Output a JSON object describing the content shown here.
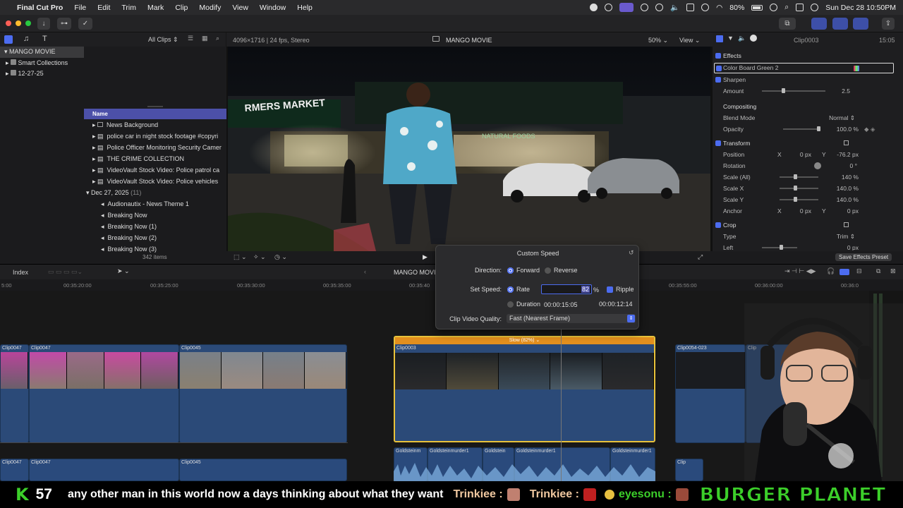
{
  "menubar": {
    "app": "Final Cut Pro",
    "items": [
      "File",
      "Edit",
      "Trim",
      "Mark",
      "Clip",
      "Modify",
      "View",
      "Window",
      "Help"
    ],
    "battery": "80%",
    "datetime": "Sun Dec 28  10:50PM"
  },
  "library": {
    "filter": "All Clips ⇕",
    "tree": [
      "MANGO MOVIE",
      "Smart Collections",
      "12-27-25"
    ],
    "col_name": "Name",
    "rows": [
      "News Background",
      "police  car in night stock footage #copyri",
      "Police Officer Monitoring Security Camer",
      "THE CRIME COLLECTION",
      "VideoVault Stock Video:   Police patrol ca",
      "VideoVault Stock Video:   Police vehicles"
    ],
    "date_group": "Dec 27, 2025",
    "date_count": "(11)",
    "audio_rows": [
      "Audionautix - News Theme 1",
      "Breaking Now",
      "Breaking Now (1)",
      "Breaking Now (2)",
      "Breaking Now (3)"
    ],
    "item_count": "342 items"
  },
  "viewer": {
    "format": "4096×1716 | 24 fps, Stereo",
    "title": "MANGO MOVIE",
    "zoom": "50% ⌄",
    "view": "View ⌄",
    "sign_text": "RMERS MARKET",
    "store_text": "NATURAL FOODS"
  },
  "inspector": {
    "clip": "Clip0003",
    "duration": "15:05",
    "effects_title": "Effects",
    "effects": [
      "Color Board Green 2",
      "Sharpen"
    ],
    "amount_label": "Amount",
    "amount_value": "2.5",
    "compositing": "Compositing",
    "blend_label": "Blend Mode",
    "blend_value": "Normal ⇕",
    "opacity_label": "Opacity",
    "opacity_value": "100.0  %",
    "transform": "Transform",
    "position_label": "Position",
    "pos_x_label": "X",
    "pos_x": "0  px",
    "pos_y_label": "Y",
    "pos_y": "-76.2  px",
    "rotation_label": "Rotation",
    "rotation": "0  °",
    "scale_all_label": "Scale (All)",
    "scale_all": "140  %",
    "scale_x_label": "Scale X",
    "scale_x": "140.0  %",
    "scale_y_label": "Scale Y",
    "scale_y": "140.0  %",
    "anchor_label": "Anchor",
    "anchor_x_label": "X",
    "anchor_x": "0  px",
    "anchor_y_label": "Y",
    "anchor_y": "0  px",
    "crop": "Crop",
    "type_label": "Type",
    "type_value": "Trim ⇕",
    "left_label": "Left",
    "left_value": "0  px",
    "save_preset": "Save Effects Preset"
  },
  "timeline_bar": {
    "index": "Index",
    "project": "MANGO MOVIE"
  },
  "ruler": [
    "5:00",
    "00:35:20:00",
    "00:35:25:00",
    "00:35:30:00",
    "00:35:35:00",
    "00:35:40",
    "00:35:55:00",
    "00:36:00:00",
    "00:36:0"
  ],
  "speed": {
    "title": "Custom Speed",
    "direction_label": "Direction:",
    "forward": "Forward",
    "reverse": "Reverse",
    "set_speed_label": "Set Speed:",
    "rate": "Rate",
    "rate_value": "82",
    "percent": "%",
    "ripple": "Ripple",
    "duration": "Duration",
    "duration_value": "00:00:15:05",
    "duration_alt": "00:00:12:14",
    "quality_label": "Clip Video Quality:",
    "quality_value": "Fast (Nearest Frame)"
  },
  "clips": {
    "c47a": "Clip0047",
    "c47b": "Clip0047",
    "c45": "Clip0045",
    "slow": "Slow (82%) ⌄",
    "c03": "Clip0003",
    "c54": "Clip0054-023",
    "c0": "Clip",
    "a47a": "Clip0047",
    "a47b": "Clip0047",
    "a45": "Clip0045",
    "gold1": "Goldsteinm",
    "gold2": "Goldsteinmurder1",
    "gold3": "Goldstein",
    "gold4": "Goldsteinmurder1",
    "gold5": "Goldsteinmurder1",
    "clp": "Clip"
  },
  "ticker": {
    "k": "K",
    "count": "57",
    "message": "any other man in this world now a days thinking about what they want",
    "user1": "Trinkiee :",
    "user2": "Trinkiee :",
    "user3": "eyesonu :",
    "brand": "BURGER  PLANET"
  },
  "colors": {
    "accent": "#4c6cf0",
    "selection": "#4c50a8",
    "clip_blue": "#2b4a78",
    "selected_clip": "#e8c23a",
    "slow_bar": "#e28f1e",
    "ticker_green": "#3ccf2a"
  }
}
